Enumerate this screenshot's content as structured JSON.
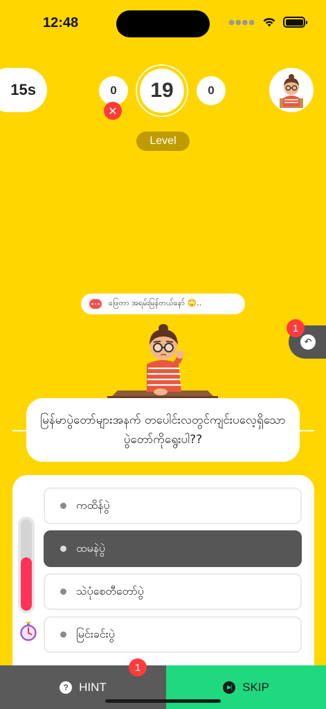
{
  "status_bar": {
    "time": "12:48"
  },
  "header": {
    "timer": "15s",
    "score_left": "0",
    "question_number": "19",
    "score_right": "0",
    "level_label": "Level"
  },
  "speech": {
    "text": "ဖြေတာ အရမ်းမြန်တယ်နော် 🙄.."
  },
  "undo": {
    "badge": "1"
  },
  "question": {
    "text": "မြန်မာပွဲတော်များအနက် တပေါင်းလတွင်ကျင်းပလေ့ရှိသော ပွဲတော်ကိုရွေးပါ??"
  },
  "options": [
    {
      "label": "ကထိန်ပွဲ",
      "selected": false
    },
    {
      "label": "ထမနဲပွဲ",
      "selected": true
    },
    {
      "label": "သဲပုံစေတီတော်ပွဲ",
      "selected": false
    },
    {
      "label": "မြင်းခင်းပွဲ",
      "selected": false
    }
  ],
  "time_progress": 0.58,
  "bottom": {
    "hint_label": "HINT",
    "hint_badge": "1",
    "skip_label": "SKIP"
  },
  "colors": {
    "background": "#ffd600",
    "skip": "#1ed97e",
    "hint": "#5a5a5a",
    "alert": "#ff3b3b",
    "selected_option": "#565656"
  }
}
